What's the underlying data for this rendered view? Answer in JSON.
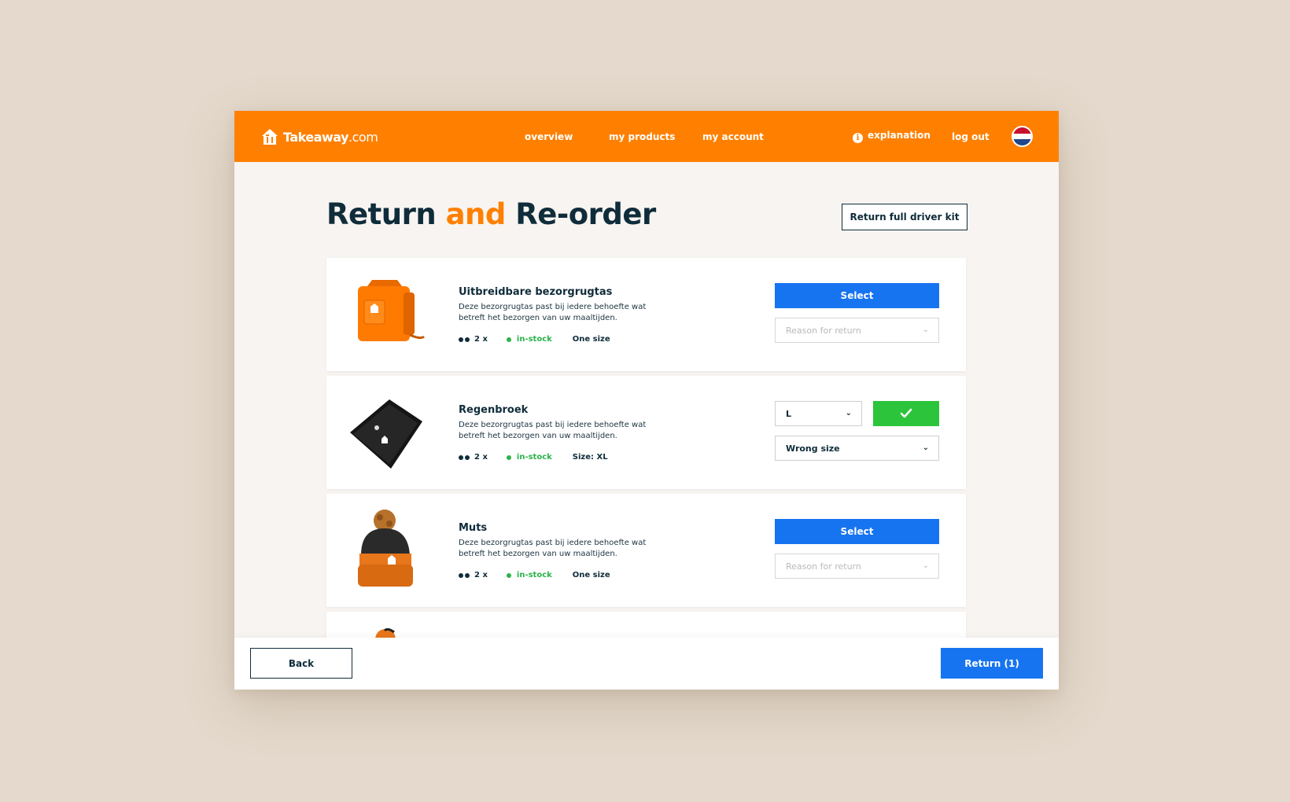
{
  "header": {
    "logo_text": "Takeaway",
    "logo_domain": ".com",
    "nav": [
      "overview",
      "my products",
      "my account"
    ],
    "explanation": "explanation",
    "logout": "log out",
    "brand_color": "#ff8000"
  },
  "page": {
    "title_part1": "Return",
    "title_part2": "and",
    "title_part3": "Re-order",
    "kit_button": "Return full driver kit"
  },
  "products": [
    {
      "name": "Uitbreidbare bezorgrugtas",
      "description": "Deze bezorgrugtas past bij iedere behoefte wat betreft het bezorgen van uw maaltijden.",
      "quantity": "2 x",
      "stock": "in-stock",
      "size": "One size",
      "select_label": "Select",
      "reason_placeholder": "Reason for return",
      "icon": "backpack-icon"
    },
    {
      "name": "Regenbroek",
      "description": "Deze bezorgrugtas past bij iedere behoefte wat betreft het bezorgen van uw maaltijden.",
      "quantity": "2 x",
      "stock": "in-stock",
      "size": "Size: XL",
      "selected_size": "L",
      "reason_value": "Wrong size",
      "icon": "rain-pants-icon"
    },
    {
      "name": "Muts",
      "description": "Deze bezorgrugtas past bij iedere behoefte wat betreft het bezorgen van uw maaltijden.",
      "quantity": "2 x",
      "stock": "in-stock",
      "size": "One size",
      "select_label": "Select",
      "reason_placeholder": "Reason for return",
      "icon": "beanie-icon"
    }
  ],
  "footer": {
    "back": "Back",
    "return": "Return (1)"
  },
  "colors": {
    "accent": "#ff8000",
    "primary": "#1774f0",
    "success": "#2bc43a",
    "text": "#0f2c3a"
  }
}
